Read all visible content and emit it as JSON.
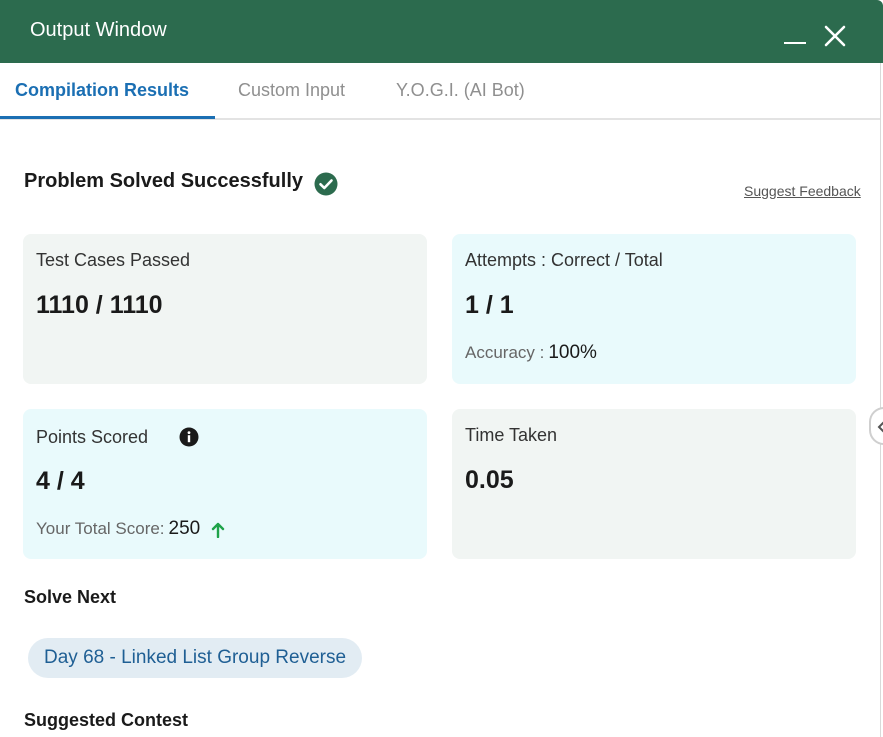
{
  "window": {
    "title": "Output Window"
  },
  "tabs": [
    {
      "label": "Compilation Results",
      "active": true
    },
    {
      "label": "Custom Input",
      "active": false
    },
    {
      "label": "Y.O.G.I. (AI Bot)",
      "active": false
    }
  ],
  "result": {
    "heading": "Problem Solved Successfully",
    "feedback_link": "Suggest Feedback"
  },
  "cards": {
    "tests": {
      "label": "Test Cases Passed",
      "value": "1110 / 1110"
    },
    "attempts": {
      "label": "Attempts : Correct / Total",
      "value": "1 / 1",
      "accuracy_label": "Accuracy :",
      "accuracy_value": "100%"
    },
    "points": {
      "label": "Points Scored",
      "value": "4 / 4",
      "total_label": "Your Total Score:",
      "total_value": "250"
    },
    "time": {
      "label": "Time Taken",
      "value": "0.05"
    }
  },
  "solve_next": {
    "title": "Solve Next",
    "problem": "Day 68 - Linked List Group Reverse"
  },
  "suggested_contest": {
    "title": "Suggested Contest"
  },
  "colors": {
    "header": "#2c6b4e",
    "accent": "#1b6fb3",
    "success": "#2c6b4e",
    "up_arrow": "#1fa34a"
  }
}
